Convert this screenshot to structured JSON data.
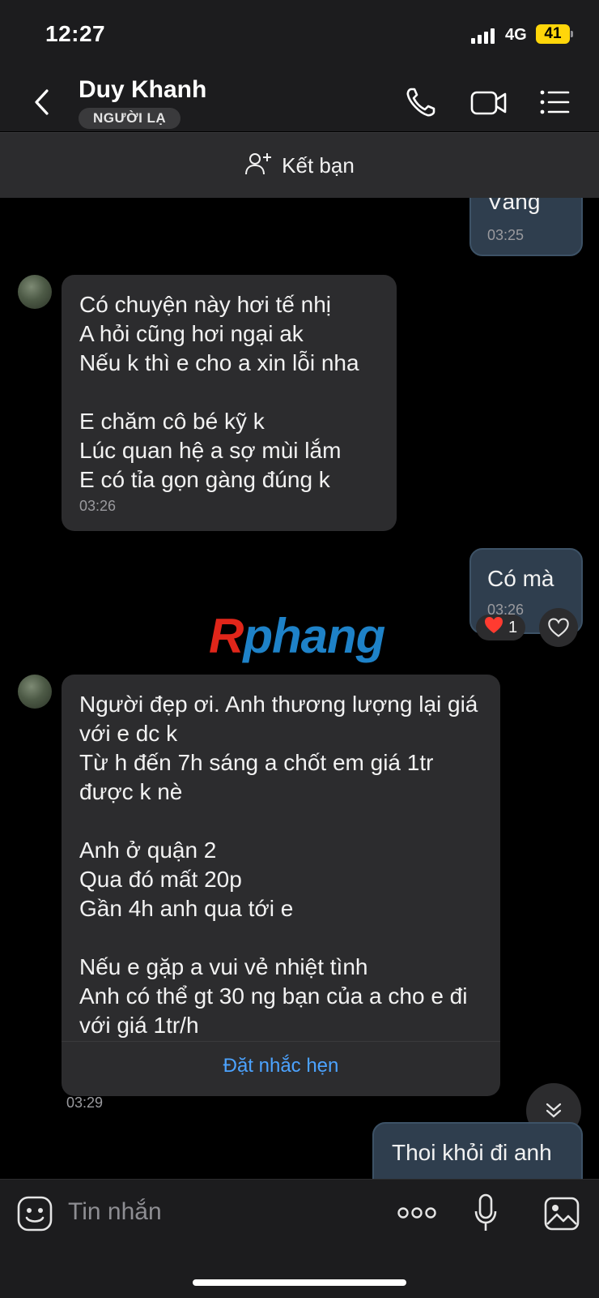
{
  "status_bar": {
    "time": "12:27",
    "network": "4G",
    "battery": "41",
    "battery_color": "#ffd60a"
  },
  "header": {
    "contact_name": "Duy Khanh",
    "stranger_badge": "NGƯỜI LẠ",
    "icons": [
      "back-icon",
      "phone-icon",
      "video-call-icon",
      "menu-icon"
    ]
  },
  "add_friend": {
    "label": "Kết bạn",
    "icon": "add-user-icon"
  },
  "messages": [
    {
      "direction": "out",
      "text": "Vâng",
      "time": "03:25"
    },
    {
      "direction": "in",
      "text": "Có chuyện này hơi tế nhị\nA hỏi cũng hơi ngại ak\nNếu k thì e cho a xin lỗi nha\n\nE chăm cô bé kỹ k\nLúc quan hệ a sợ mùi lắm\nE có tỉa gọn gàng đúng k",
      "time": "03:26"
    },
    {
      "direction": "out",
      "text": "Có mà",
      "time": "03:26",
      "reaction_count": "1"
    },
    {
      "direction": "in",
      "text": "Người đẹp ơi. Anh thương lượng lại giá với e dc k\nTừ h đến 7h sáng a chốt em giá 1tr được k nè\n\nAnh ở quận 2\nQua đó mất 20p\nGần 4h anh qua tới e\n\nNếu e gặp a vui vẻ nhiệt tình\nAnh có thể gt 30 ng bạn của a cho e đi với giá 1tr/h",
      "time": "03:29",
      "action": "Đặt nhắc hẹn"
    },
    {
      "direction": "out",
      "text": "Thoi khỏi đi anh"
    }
  ],
  "watermark": "Rphang",
  "input": {
    "placeholder": "Tin nhắn",
    "icons": [
      "sticker-icon",
      "more-icon",
      "microphone-icon",
      "image-icon"
    ]
  },
  "colors": {
    "background": "#000000",
    "bubble_in": "#2c2c2e",
    "bubble_out": "#2f3e4e",
    "link": "#4ca3ff",
    "reaction_heart": "#ff3b30"
  }
}
